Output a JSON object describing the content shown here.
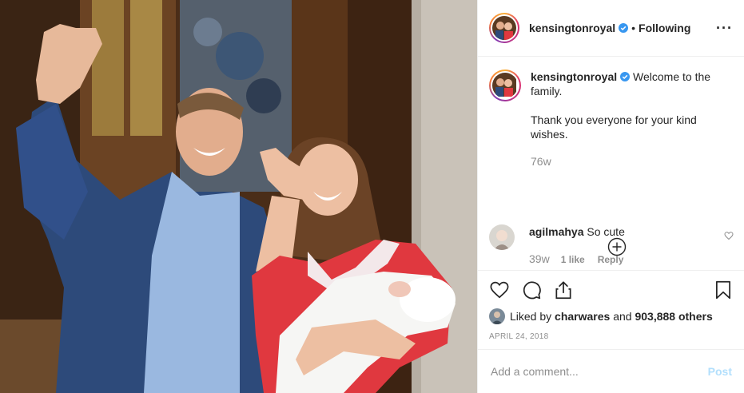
{
  "post": {
    "author": "kensingtonroyal",
    "follow_status": "Following",
    "caption_line1": "Welcome to the family.",
    "caption_line2": "Thank you everyone for your kind wishes.",
    "caption_time": "76w"
  },
  "comments": [
    {
      "username": "agilmahya",
      "text": "So cute",
      "age": "39w",
      "likes": "1 like",
      "reply_label": "Reply"
    }
  ],
  "likes": {
    "prefix": "Liked by",
    "user": "charwares",
    "middle": "and",
    "count_text": "903,888 others"
  },
  "date": "APRIL 24, 2018",
  "composer": {
    "placeholder": "Add a comment...",
    "post_label": "Post"
  },
  "icons": {
    "header_more": "more-options-icon",
    "verified": "verified-badge-icon",
    "load_more": "plus-circle-icon",
    "like": "heart-icon",
    "comment": "comment-icon",
    "share": "share-icon",
    "save": "bookmark-icon"
  },
  "colors": {
    "accent_blue": "#3897f0",
    "post_disabled": "#b2dffc",
    "muted_text": "#8e8e8e"
  }
}
